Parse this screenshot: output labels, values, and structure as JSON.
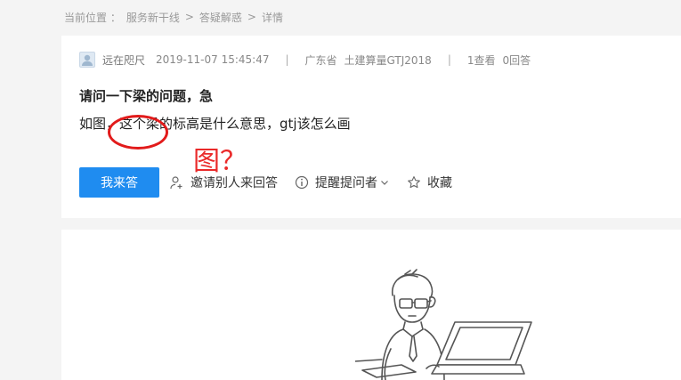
{
  "breadcrumb": {
    "label": "当前位置 ：",
    "items": [
      "服务新干线",
      "答疑解惑",
      "详情"
    ],
    "separator": ">"
  },
  "question": {
    "user": "远在咫尺",
    "time": "2019-11-07 15:45:47",
    "divider": "|",
    "province": "广东省",
    "topic": "土建算量GTJ2018",
    "views": "1查看",
    "answers": "0回答",
    "title": "请问一下梁的问题，急",
    "content": "如图，这个梁的标高是什么意思，gtj该怎么画"
  },
  "annotation": {
    "text": "图？",
    "color": "#ea2a2a"
  },
  "actions": {
    "answer_button": "我来答",
    "invite": "邀请别人来回答",
    "remind": "提醒提问者",
    "favorite": "收藏"
  },
  "colors": {
    "primary": "#1f8cf0",
    "page_bg": "#f4f4f4",
    "annotation_red": "#e21b1b"
  },
  "icons": {
    "invite": "user-plus-icon",
    "remind": "info-circle-icon",
    "favorite": "star-icon",
    "dropdown": "chevron-down-icon"
  }
}
